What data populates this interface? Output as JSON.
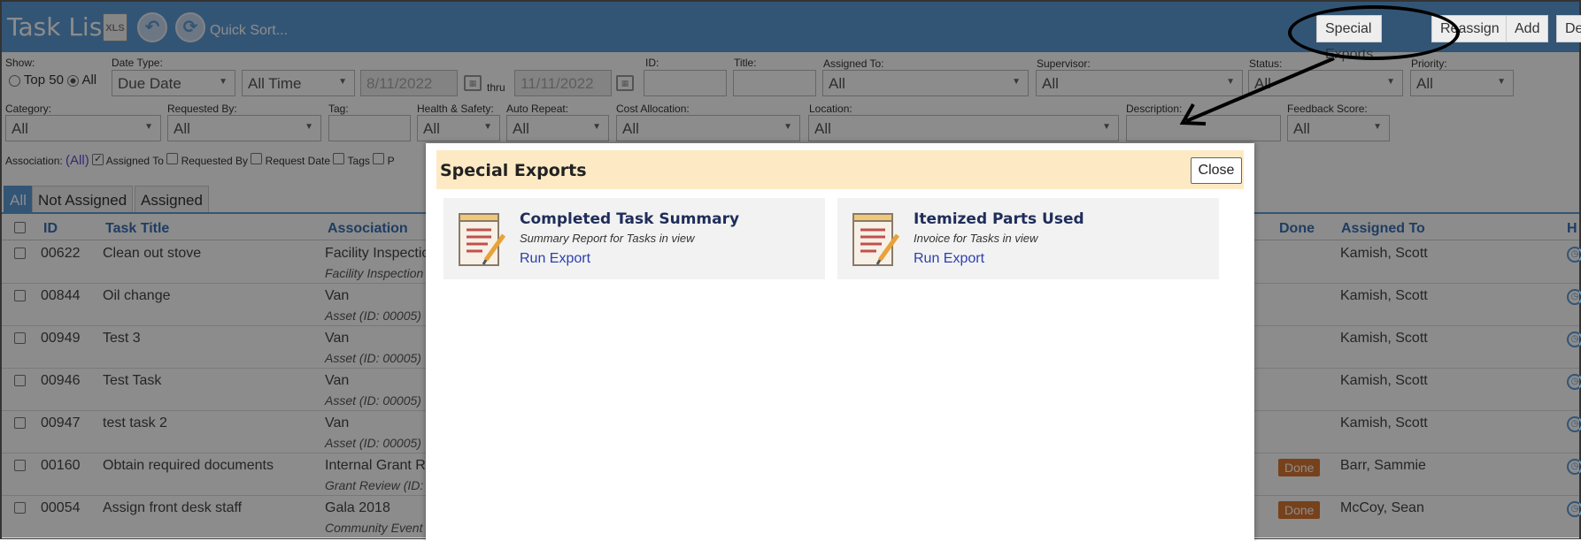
{
  "header": {
    "title": "Task List",
    "xls_label": "XLS",
    "quick_sort": "Quick Sort...",
    "buttons": {
      "special_exports": "Special Exports",
      "reassign": "Reassign",
      "add": "Add",
      "delete": "De"
    }
  },
  "filters": {
    "show_label": "Show:",
    "top50_label": "Top 50",
    "all_label": "All",
    "date_type_label": "Date Type:",
    "date_type_value": "Due Date",
    "time_range_value": "All Time",
    "date_from": "8/11/2022",
    "thru_label": "thru",
    "date_to": "11/11/2022",
    "id_label": "ID:",
    "title_label": "Title:",
    "assigned_to_label": "Assigned To:",
    "assigned_to_value": "All",
    "supervisor_label": "Supervisor:",
    "supervisor_value": "All",
    "status_label": "Status:",
    "status_value": "All",
    "priority_label": "Priority:",
    "priority_value": "All",
    "category_label": "Category:",
    "category_value": "All",
    "requested_by_label": "Requested By:",
    "requested_by_value": "All",
    "tag_label": "Tag:",
    "health_safety_label": "Health & Safety:",
    "health_safety_value": "All",
    "auto_repeat_label": "Auto Repeat:",
    "auto_repeat_value": "All",
    "cost_allocation_label": "Cost Allocation:",
    "cost_allocation_value": "All",
    "location_label": "Location:",
    "location_value": "All",
    "description_label": "Description:",
    "feedback_score_label": "Feedback Score:",
    "feedback_score_value": "All",
    "association_label": "Association:",
    "association_value": "(All)",
    "checks": {
      "assigned_to": "Assigned To",
      "requested_by": "Requested By",
      "request_date": "Request Date",
      "tags": "Tags",
      "p": "P"
    }
  },
  "tabs": [
    "All",
    "Not Assigned",
    "Assigned"
  ],
  "table": {
    "columns": {
      "id": "ID",
      "task_title": "Task Title",
      "association": "Association",
      "done": "Done",
      "assigned_to": "Assigned To",
      "h": "H"
    },
    "rows": [
      {
        "id": "00622",
        "title": "Clean out stove",
        "assoc": "Facility Inspection",
        "assoc_sub": "Facility Inspection",
        "done": "",
        "assigned": "Kamish, Scott"
      },
      {
        "id": "00844",
        "title": "Oil change",
        "assoc": "Van",
        "assoc_sub": "Asset  (ID: 00005)",
        "done": "",
        "assigned": "Kamish, Scott"
      },
      {
        "id": "00949",
        "title": "Test 3",
        "assoc": "Van",
        "assoc_sub": "Asset  (ID: 00005)",
        "done": "",
        "assigned": "Kamish, Scott"
      },
      {
        "id": "00946",
        "title": "Test Task",
        "assoc": "Van",
        "assoc_sub": "Asset  (ID: 00005)",
        "done": "",
        "assigned": "Kamish, Scott"
      },
      {
        "id": "00947",
        "title": "test task 2",
        "assoc": "Van",
        "assoc_sub": "Asset  (ID: 00005)",
        "done": "",
        "assigned": "Kamish, Scott"
      },
      {
        "id": "00160",
        "title": "Obtain required documents",
        "assoc": "Internal Grant Re",
        "assoc_sub": "Grant Review  (ID:",
        "done": "Done",
        "assigned": "Barr, Sammie"
      },
      {
        "id": "00054",
        "title": "Assign front desk staff",
        "assoc": "Gala 2018",
        "assoc_sub": "Community Event",
        "done": "Done",
        "assigned": "McCoy, Sean"
      }
    ]
  },
  "modal": {
    "title": "Special Exports",
    "close_label": "Close",
    "cards": [
      {
        "title": "Completed Task Summary",
        "subtitle": "Summary Report for Tasks in view",
        "link": "Run Export"
      },
      {
        "title": "Itemized Parts Used",
        "subtitle": "Invoice for Tasks in view",
        "link": "Run Export"
      }
    ]
  },
  "colors": {
    "header_bg": "#5e9bd6",
    "modal_header_bg": "#fdeac5",
    "done_badge": "#d97732",
    "link": "#2b3fb0"
  }
}
